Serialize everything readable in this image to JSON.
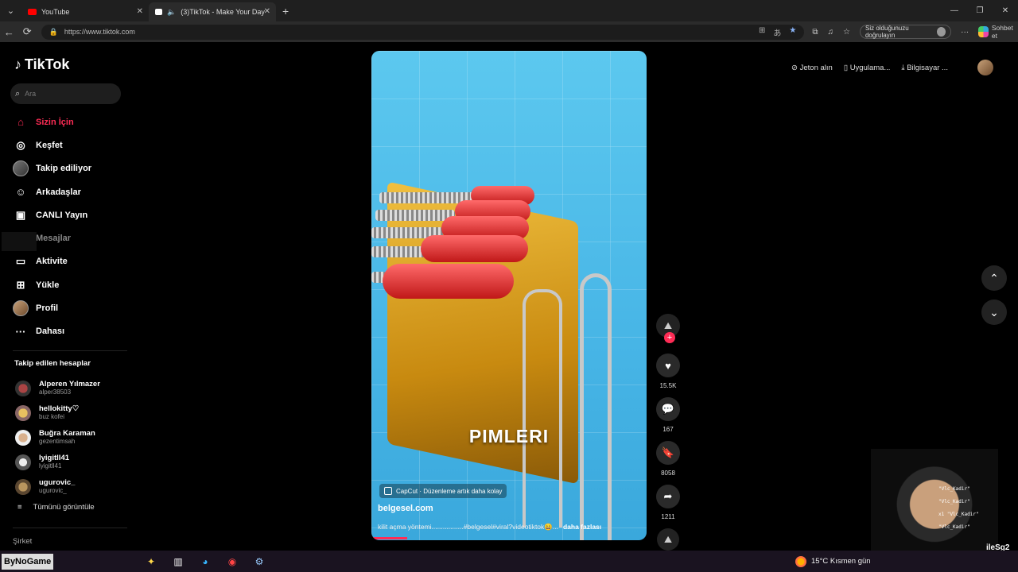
{
  "browser": {
    "tabs": [
      {
        "title": "YouTube",
        "favicon_color": "#ff0000"
      },
      {
        "title": "(3)TikTok - Make Your Day",
        "favicon_color": "#ffffff"
      }
    ],
    "url": "https://www.tiktok.com",
    "verify_label": "Siz olduğunuzu doğrulayın",
    "copilot_label": "Sohbet et"
  },
  "sidebar": {
    "brand": "TikTok",
    "search_placeholder": "Ara",
    "nav": [
      {
        "label": "Sizin İçin",
        "icon": "home-icon"
      },
      {
        "label": "Keşfet",
        "icon": "compass-icon"
      },
      {
        "label": "Takip ediliyor",
        "icon": "avatar-icon"
      },
      {
        "label": "Arkadaşlar",
        "icon": "friends-icon"
      },
      {
        "label": "CANLI Yayın",
        "icon": "live-icon"
      },
      {
        "label": "Mesajlar",
        "icon": "message-icon"
      },
      {
        "label": "Aktivite",
        "icon": "activity-icon"
      },
      {
        "label": "Yükle",
        "icon": "upload-icon"
      },
      {
        "label": "Profil",
        "icon": "profile-icon"
      },
      {
        "label": "Dahası",
        "icon": "more-icon"
      }
    ],
    "followed_header": "Takip edilen hesaplar",
    "followed": [
      {
        "name": "Alperen Yılmazer",
        "handle": "alper38503"
      },
      {
        "name": "hellokitty♡",
        "handle": "buz kofei"
      },
      {
        "name": "Buğra Karaman",
        "handle": "gezentimsah"
      },
      {
        "name": "lyigitll41",
        "handle": "lyigitll41"
      },
      {
        "name": "ugurovic_",
        "handle": "ugurovic_"
      }
    ],
    "see_all": "Tümünü görüntüle",
    "company": "Şirket"
  },
  "video": {
    "caption": "PIMLERI",
    "capcut": "CapCut · Düzenleme artık daha kolay",
    "author": "belgesel.com",
    "description": "kilit açma yöntemi.................#belgesel#viral?videotiktok😄...",
    "more": "daha fazlası",
    "progress": 0.13
  },
  "actions": {
    "likes": "15.5K",
    "comments": "167",
    "saves": "8058",
    "shares": "1211"
  },
  "topbar": {
    "coins": "Jeton alın",
    "app": "Uygulama...",
    "pc": "Bilgisayar ..."
  },
  "overlay": {
    "chat_lines": [
      "\"Vlc_Kadir\"",
      "\"Vlc_Kadir\"",
      "x1 \"Vlc_Kadir\"",
      "\"Vlc_Kadir\""
    ],
    "corner_tag": "ileSg2"
  },
  "taskbar": {
    "brand": "ByNoGame",
    "weather": "15°C  Kısmen gün"
  }
}
